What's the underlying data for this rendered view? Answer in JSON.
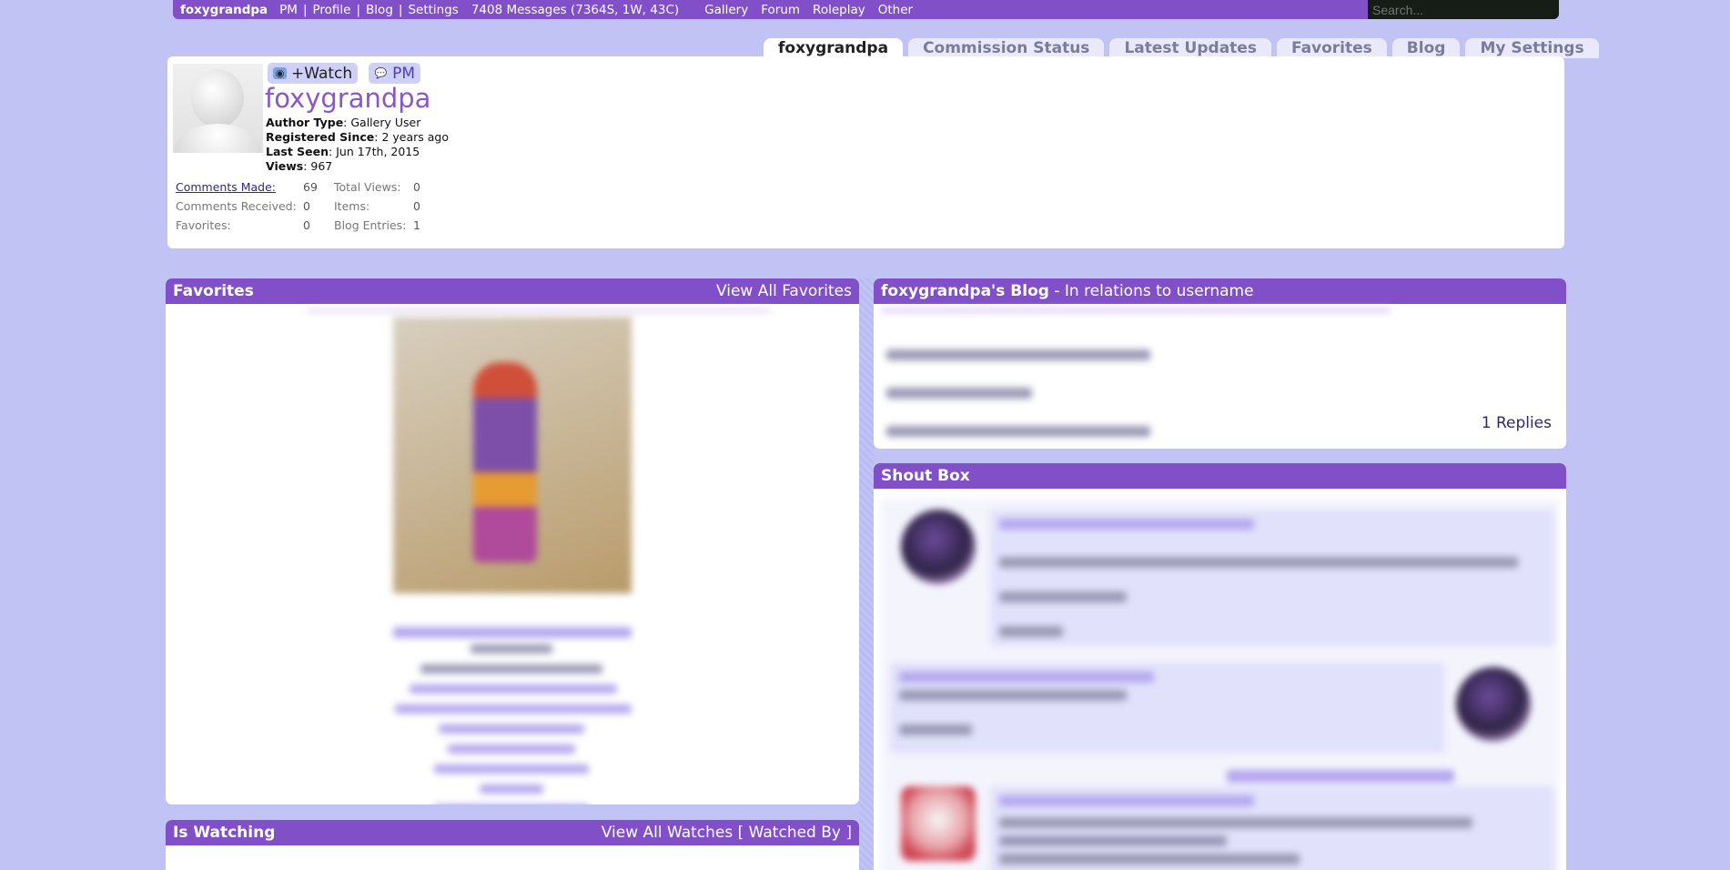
{
  "topbar": {
    "username": "foxygrandpa",
    "links": [
      "PM",
      "Profile",
      "Blog",
      "Settings"
    ],
    "messages": "7408 Messages (7364S, 1W, 43C)",
    "menu": [
      "Gallery",
      "Forum",
      "Roleplay",
      "Other"
    ],
    "search_placeholder": "Search..."
  },
  "tabs": [
    "foxygrandpa",
    "Commission Status",
    "Latest Updates",
    "Favorites",
    "Blog",
    "My Settings"
  ],
  "profile": {
    "watch_label": "+Watch",
    "pm_label": "PM",
    "name": "foxygrandpa",
    "author_type_label": "Author Type",
    "author_type": "Gallery User",
    "registered_label": "Registered Since",
    "registered": "2 years ago",
    "last_seen_label": "Last Seen",
    "last_seen": "Jun 17th, 2015",
    "views_label": "Views",
    "views": "967",
    "stats": [
      {
        "label": "Comments Made:",
        "value": "69",
        "label2": "Total Views:",
        "value2": "0"
      },
      {
        "label": "Comments Received:",
        "value": "0",
        "label2": "Items:",
        "value2": "0"
      },
      {
        "label": "Favorites:",
        "value": "0",
        "label2": "Blog Entries:",
        "value2": "1"
      }
    ]
  },
  "favorites": {
    "title": "Favorites",
    "view_all": "View All Favorites"
  },
  "watching": {
    "title": "Is Watching",
    "view_all": "View All Watches",
    "watched_by": "[ Watched By ]"
  },
  "blog": {
    "title": "foxygrandpa's Blog",
    "subtitle": " - In relations to username",
    "replies": "1 Replies"
  },
  "shoutbox": {
    "title": "Shout Box"
  },
  "colors": {
    "background": "#c2c3f5",
    "accent": "#8150c8",
    "tab": "#e9e9fb"
  }
}
